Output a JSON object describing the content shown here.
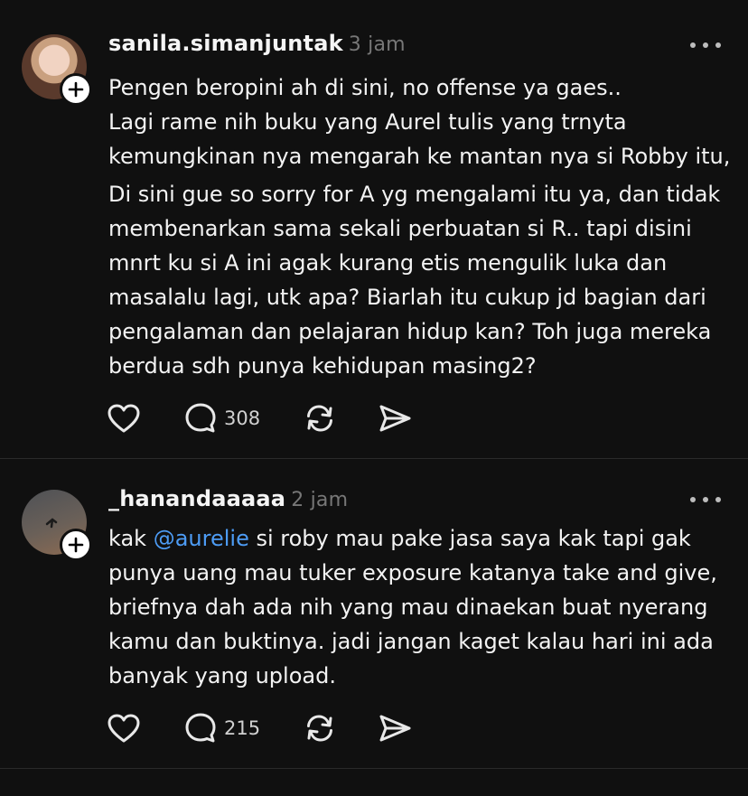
{
  "posts": [
    {
      "username": "sanila.simanjuntak",
      "time": "3 jam",
      "lines": [
        "Pengen beropini ah di sini, no offense ya gaes..",
        "Lagi rame nih buku yang Aurel tulis yang trnyta",
        "kemungkinan nya mengarah ke mantan nya si Robby itu,",
        "Di sini gue so sorry for A yg mengalami itu ya, dan tidak",
        "membenarkan sama sekali perbuatan si R.. tapi disini",
        "mnrt ku si A ini agak kurang etis mengulik luka dan",
        "masalalu lagi, utk apa? Biarlah itu cukup jd bagian dari",
        "pengalaman dan pelajaran hidup kan? Toh juga mereka",
        "berdua sdh punya kehidupan masing2?"
      ],
      "reply_count": "308",
      "icons": [
        "heart-icon",
        "comment-icon",
        "repost-icon",
        "share-icon"
      ]
    },
    {
      "username": "_hanandaaaaa",
      "time": "2 jam",
      "line1_prefix": "kak ",
      "mention": "@aurelie",
      "line1_suffix": " si roby mau pake jasa saya kak tapi gak",
      "lines": [
        "punya uang mau tuker exposure katanya take and give,",
        "briefnya dah ada nih yang mau dinaekan buat nyerang",
        "kamu dan buktinya. jadi jangan kaget kalau hari ini ada",
        "banyak yang upload."
      ],
      "reply_count": "215",
      "icons": [
        "heart-icon",
        "comment-icon",
        "repost-icon",
        "share-icon"
      ]
    }
  ],
  "colors": {
    "background": "#101010",
    "text": "#f3f3f3",
    "muted": "#777777",
    "mention": "#4d9cf5",
    "divider": "#2a2a2a"
  }
}
